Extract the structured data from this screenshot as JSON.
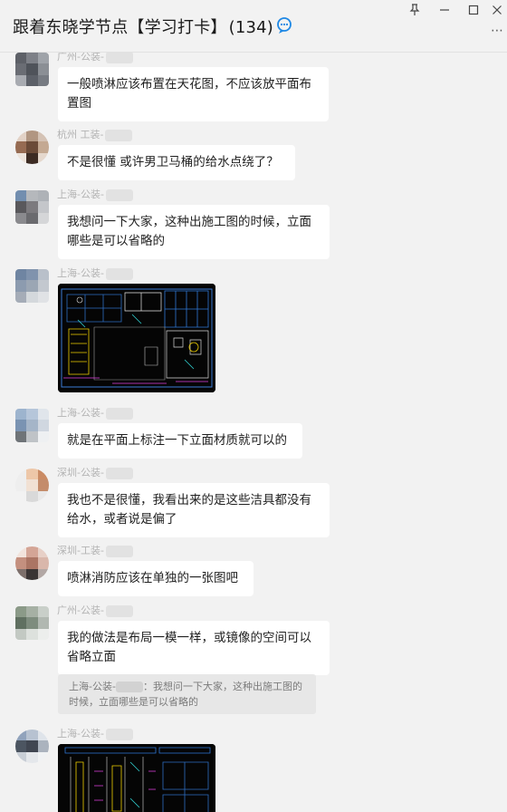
{
  "header": {
    "title": "跟着东晓学节点【学习打卡】",
    "member_count": "(134)",
    "title_icon": "chat-bubble-icon",
    "window_buttons": [
      "pin-icon",
      "minimize-icon",
      "maximize-icon",
      "close-icon"
    ],
    "more_icon": "more-icon"
  },
  "messages": [
    {
      "sender": "广州-公装-",
      "text": "一般喷淋应该布置在天花图，不应该放平面布置图"
    },
    {
      "sender": "杭州 工装-",
      "text": "不是很懂 或许男卫马桶的给水点绕了？"
    },
    {
      "sender": "上海-公装-",
      "text": "我想问一下大家，这种出施工图的时候，立面哪些是可以省略的"
    },
    {
      "sender": "上海-公装-",
      "image": "cad-drawing-image"
    },
    {
      "sender": "上海-公装-",
      "text": "就是在平面上标注一下立面材质就可以的"
    },
    {
      "sender": "深圳-公装-",
      "text": "我也不是很懂，我看出来的是这些洁具都没有给水，或者说是偏了"
    },
    {
      "sender": "深圳-工装-",
      "text": "喷淋消防应该在单独的一张图吧"
    },
    {
      "sender": "广州-公装-",
      "text": "我的做法是布局一模一样，或镜像的空间可以省略立面",
      "quote": {
        "sender": "上海-公装-",
        "text": "：我想问一下大家，这种出施工图的时候，立面哪些是可以省略的"
      }
    },
    {
      "sender": "上海-公装-",
      "image": "cad-drawing-image"
    }
  ]
}
